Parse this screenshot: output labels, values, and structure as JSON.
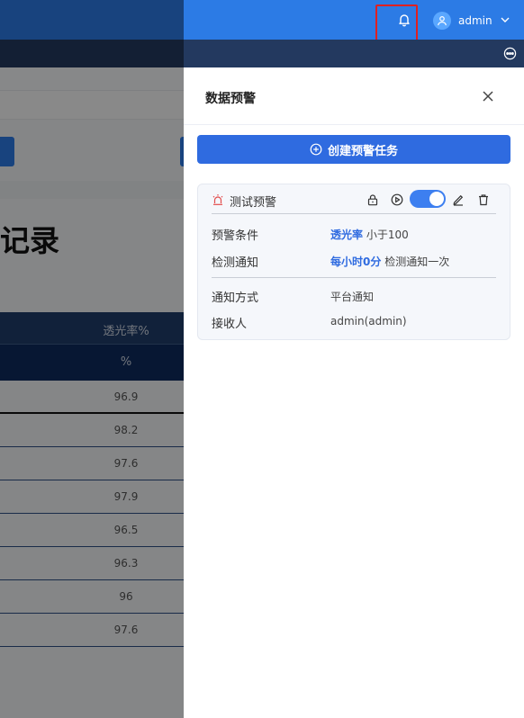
{
  "header": {
    "username": "admin",
    "bell_icon": "bell-icon",
    "user_icon": "user-icon",
    "more_icon": "more-horizontal-circle-icon",
    "brand_color": "#2c7be5"
  },
  "background_page": {
    "title_fragment": "记录",
    "table": {
      "header_row1": "透光率%",
      "header_row2": "%",
      "values": [
        "96.9",
        "98.2",
        "97.6",
        "97.9",
        "96.5",
        "96.3",
        "96",
        "97.6"
      ]
    }
  },
  "drawer": {
    "title": "数据预警",
    "close_icon": "close-icon",
    "create_button": "创建预警任务",
    "task": {
      "name": "测试预警",
      "condition_label": "预警条件",
      "condition_metric": "透光率",
      "condition_rule": "小于100",
      "schedule_label": "检测通知",
      "schedule_time": "每小时0分",
      "schedule_desc": "检测通知一次",
      "method_label": "通知方式",
      "method_value": "平台通知",
      "receiver_label": "接收人",
      "receiver_value": "admin(admin)",
      "enabled": true,
      "accent_color": "#2f6be0",
      "alarm_color": "#e24c4c"
    }
  }
}
